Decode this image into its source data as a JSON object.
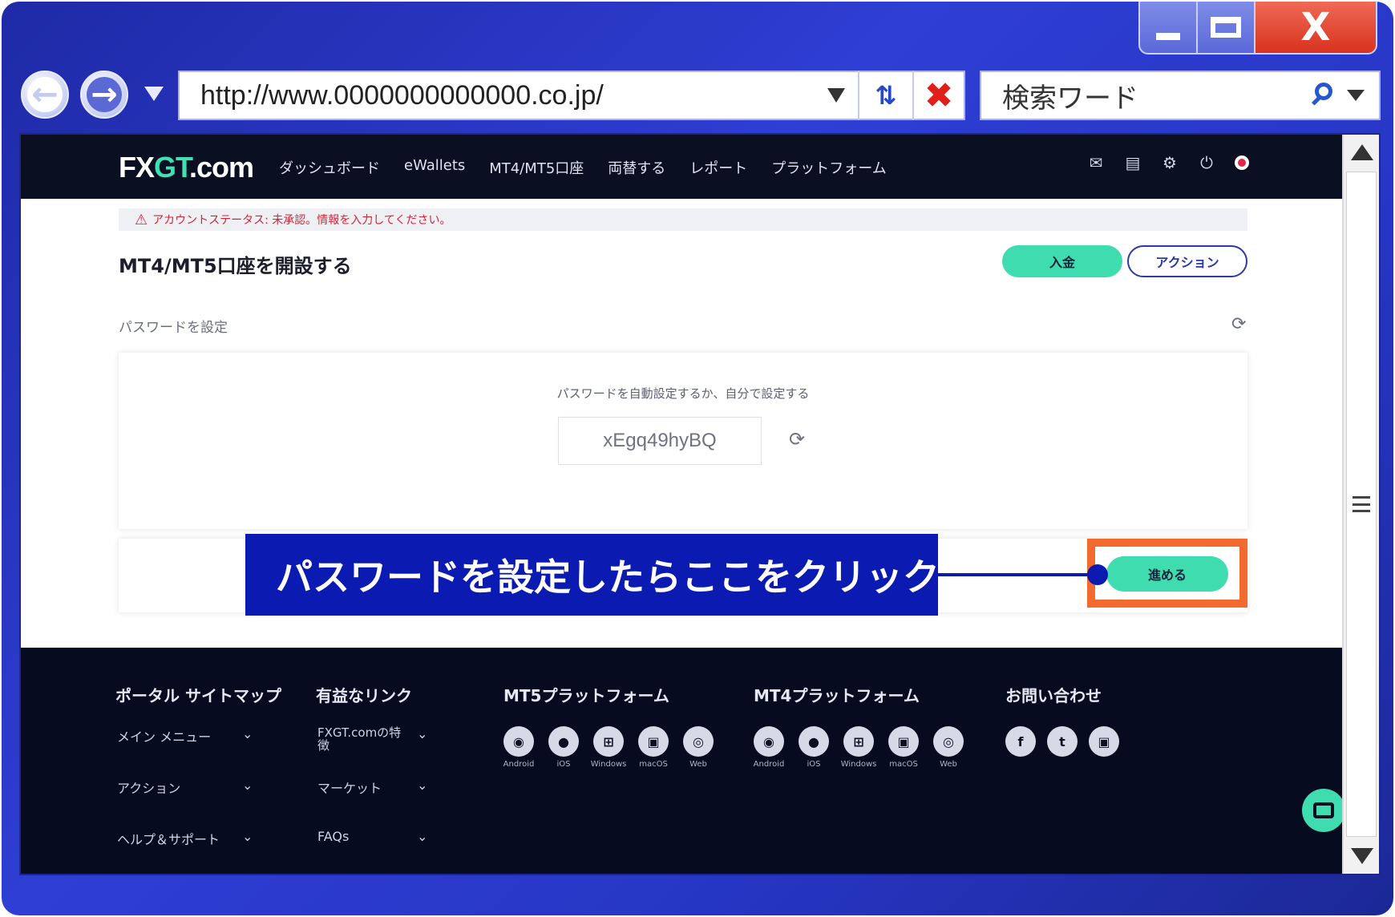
{
  "browser": {
    "close_glyph": "X",
    "url": "http://www.0000000000000.co.jp/",
    "search_placeholder": "検索ワード"
  },
  "site": {
    "logo_part1": "FX",
    "logo_part2": "GT",
    "logo_part3": ".com",
    "nav": [
      "ダッシュボード",
      "eWallets",
      "MT4/MT5口座",
      "両替する",
      "レポート",
      "プラットフォーム"
    ],
    "alert": "アカウントステータス: 未承認。情報を入力してください。",
    "page_title": "MT4/MT5口座を開設する",
    "deposit_label": "入金",
    "action_label": "アクション",
    "section_label": "パスワードを設定",
    "card_hint": "パスワードを自動設定するか、自分で設定する",
    "password_value": "xEgq49hyBQ",
    "next_label": "進める"
  },
  "annotation": {
    "callout": "パスワードを設定したらここをクリック"
  },
  "footer": {
    "col1": {
      "title": "ポータル サイトマップ",
      "links": [
        "メイン メニュー",
        "アクション",
        "ヘルプ＆サポート"
      ]
    },
    "col2": {
      "title": "有益なリンク",
      "links": [
        "FXGT.comの特徴",
        "マーケット",
        "FAQs"
      ]
    },
    "col3": {
      "title": "MT5プラットフォーム"
    },
    "col4": {
      "title": "MT4プラットフォーム"
    },
    "col5": {
      "title": "お問い合わせ"
    },
    "apps": [
      "Android",
      "iOS",
      "Windows",
      "macOS",
      "Web"
    ]
  }
}
